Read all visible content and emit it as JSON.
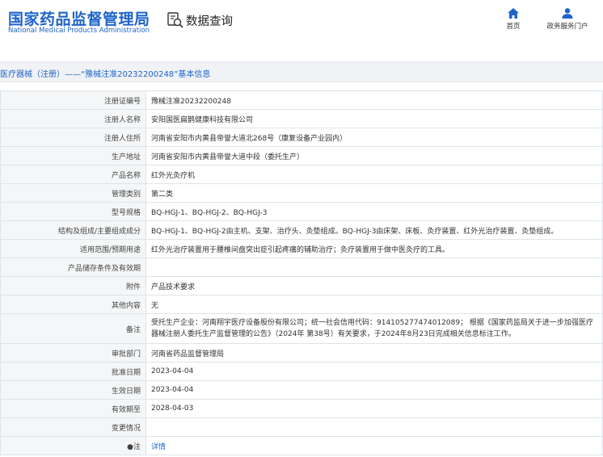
{
  "header": {
    "logo_cn": "国家药品监督管理局",
    "logo_en": "National Medical Products Administration",
    "page_name": "数据查询",
    "nav": {
      "home_label": "首页",
      "service_label": "政务服务门户"
    }
  },
  "title": "医疗器械（注册）——“豫械注准20232200248”基本信息",
  "rows": [
    {
      "label": "注册证编号",
      "value": "豫械注准20232200248"
    },
    {
      "label": "注册人名称",
      "value": "安阳国医扁鹊健康科技有限公司"
    },
    {
      "label": "注册人住所",
      "value": "河南省安阳市内黄县帝誉大道北268号（康复设备产业园内）"
    },
    {
      "label": "生产地址",
      "value": "河南省安阳市内黄县帝誉大道中段（委托生产）"
    },
    {
      "label": "产品名称",
      "value": "红外光灸疗机"
    },
    {
      "label": "管理类别",
      "value": "第二类"
    },
    {
      "label": "型号规格",
      "value": "BQ-HGJ-1、BQ-HGJ-2、BQ-HGJ-3"
    },
    {
      "label": "结构及组成/主要组成成分",
      "value": "BQ-HGJ-1、BQ-HGJ-2由主机、支架、治疗头、灸垫组成。BQ-HGJ-3由床架、床板、灸疗装置、红外光治疗装置、灸垫组成。"
    },
    {
      "label": "适用范围/预期用途",
      "value": "红外光治疗装置用于腰椎间盘突出症引起疼痛的辅助治疗；灸疗装置用于做中医灸疗的工具。"
    },
    {
      "label": "产品储存条件及有效期",
      "value": ""
    },
    {
      "label": "附件",
      "value": "产品技术要求"
    },
    {
      "label": "其他内容",
      "value": "无"
    },
    {
      "label": "备注",
      "value": "受托生产企业：河南翔宇医疗设备股份有限公司；统一社会信用代码：914105277474012089； 根据《国家药监局关于进一步加强医疗器械注册人委托生产监督管理的公告》（2024年 第38号）有关要求，于2024年8月23日完成相关信息标注工作。"
    },
    {
      "label": "审批部门",
      "value": "河南省药品监督管理局"
    },
    {
      "label": "批准日期",
      "value": "2023-04-04"
    },
    {
      "label": "生效日期",
      "value": "2023-04-04"
    },
    {
      "label": "有效期至",
      "value": "2028-04-03"
    },
    {
      "label": "变更情况",
      "value": ""
    },
    {
      "label": "●注",
      "value": "详情"
    }
  ],
  "colors": {
    "brand_blue": "#1f64c8",
    "label_bg": "#f5f6f7",
    "border": "#dfe3e8"
  },
  "icons": {
    "page_name_icon": "search-document-icon",
    "home_icon": "home-icon",
    "service_icon": "user-icon"
  }
}
